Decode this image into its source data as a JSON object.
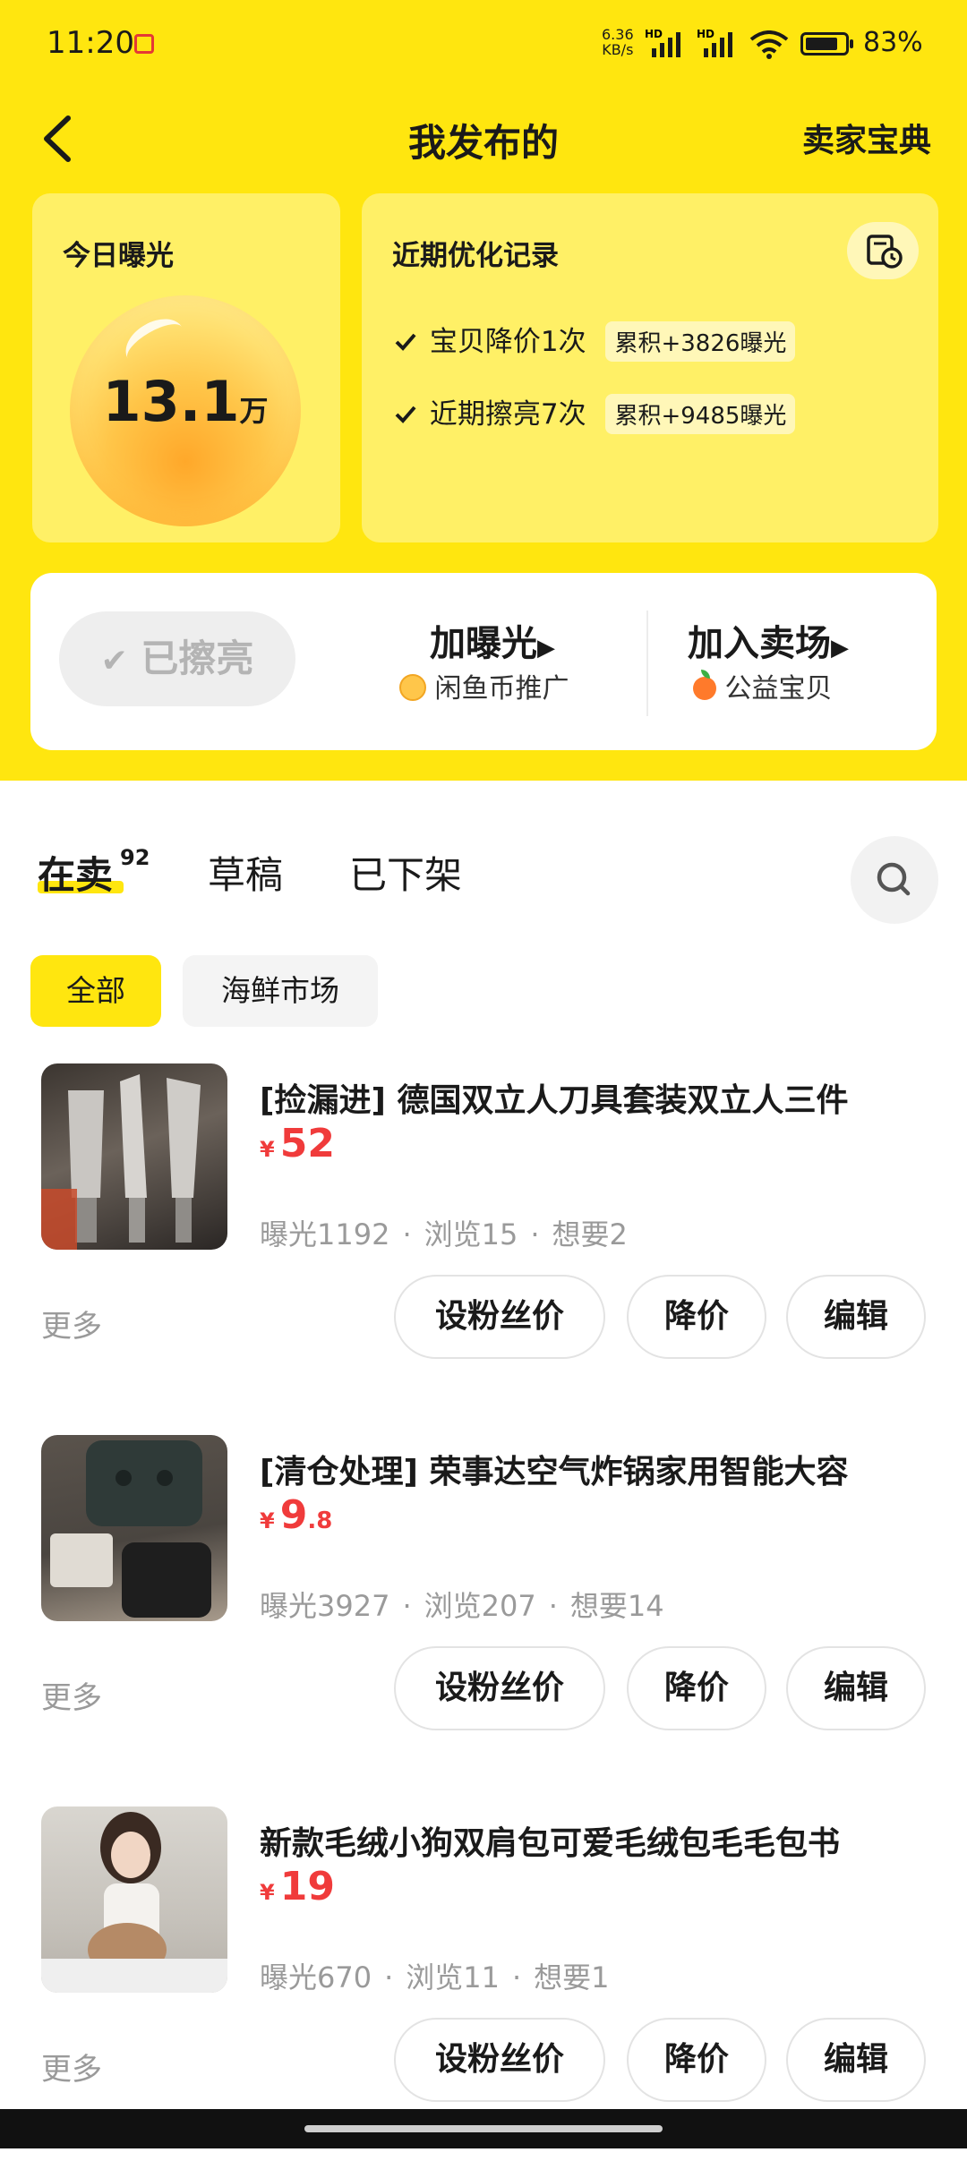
{
  "status_bar": {
    "time": "11:20",
    "network_speed_value": "6.36",
    "network_speed_unit": "KB/s",
    "hd1": "HD",
    "hd2": "HD",
    "battery_percent": "83%",
    "battery_level": 0.83
  },
  "nav": {
    "title": "我发布的",
    "right_link": "卖家宝典"
  },
  "exposure_card": {
    "title": "今日曝光",
    "value": "13.1",
    "unit": "万"
  },
  "optimization_card": {
    "title": "近期优化记录",
    "records": [
      {
        "text": "宝贝降价1次",
        "tag": "累积+3826曝光"
      },
      {
        "text": "近期擦亮7次",
        "tag": "累积+9485曝光"
      }
    ]
  },
  "actions": {
    "polished_label": "已擦亮",
    "boost_title": "加曝光",
    "boost_sub": "闲鱼币推广",
    "market_title": "加入卖场",
    "market_sub": "公益宝贝"
  },
  "tabs": [
    {
      "label": "在卖",
      "count": "92",
      "active": true
    },
    {
      "label": "草稿",
      "active": false
    },
    {
      "label": "已下架",
      "active": false
    }
  ],
  "filters": [
    {
      "label": "全部",
      "active": true
    },
    {
      "label": "海鲜市场",
      "active": false
    }
  ],
  "listings": [
    {
      "title": "[捡漏进] 德国双立人刀具套装双立人三件",
      "price_yen": "¥",
      "price_int": "52",
      "price_dec": "",
      "exposure": "曝光1192",
      "views": "浏览15",
      "wants": "想要2",
      "more": "更多",
      "btn_fan_price": "设粉丝价",
      "btn_reduce": "降价",
      "btn_edit": "编辑"
    },
    {
      "title": "[清仓处理] 荣事达空气炸锅家用智能大容",
      "price_yen": "¥",
      "price_int": "9",
      "price_dec": ".8",
      "exposure": "曝光3927",
      "views": "浏览207",
      "wants": "想要14",
      "more": "更多",
      "btn_fan_price": "设粉丝价",
      "btn_reduce": "降价",
      "btn_edit": "编辑"
    },
    {
      "title": "新款毛绒小狗双肩包可爱毛绒包毛毛包书",
      "price_yen": "¥",
      "price_int": "19",
      "price_dec": "",
      "exposure": "曝光670",
      "views": "浏览11",
      "wants": "想要1",
      "more": "更多",
      "btn_fan_price": "设粉丝价",
      "btn_reduce": "降价",
      "btn_edit": "编辑"
    }
  ],
  "colors": {
    "brand_yellow": "#FFE60F",
    "card_yellow": "#FFF066",
    "price_red": "#F03B3B",
    "muted_gray": "#9A9A9A"
  },
  "icons": [
    "back-arrow-icon",
    "history-icon",
    "check-icon",
    "search-icon",
    "coin-icon",
    "fruit-icon",
    "caret-right-icon",
    "wifi-icon",
    "signal-icon",
    "battery-icon"
  ]
}
